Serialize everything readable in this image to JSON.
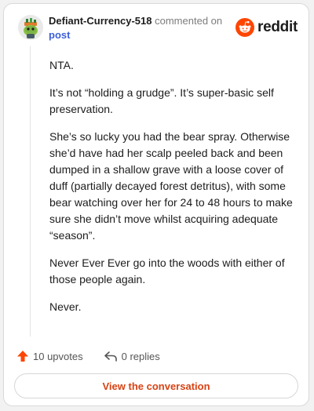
{
  "header": {
    "username": "Defiant-Currency-518",
    "action_text": "commented on",
    "post_link": "post"
  },
  "brand": {
    "wordmark": "reddit",
    "icon": "reddit-alien-icon",
    "color": "#ff4500"
  },
  "comment": {
    "paragraphs": [
      "NTA.",
      "It’s not “holding a grudge”. It’s super-basic self preservation.",
      "She’s so lucky you had the bear spray. Otherwise she’d have had her scalp peeled back and been dumped in a shallow grave with a loose cover of duff (partially decayed forest detritus), with some bear watching over her for 24 to 48 hours to make sure she didn’t move whilst acquiring adequate “season”.",
      "Never Ever Ever go into the woods with either of those people again.",
      "Never."
    ]
  },
  "actions": {
    "upvotes_label": "10 upvotes",
    "upvote_icon": "upvote-arrow-icon",
    "replies_label": "0 replies",
    "reply_icon": "reply-icon"
  },
  "footer": {
    "view_button_label": "View the conversation",
    "accent_color": "#d84315"
  }
}
